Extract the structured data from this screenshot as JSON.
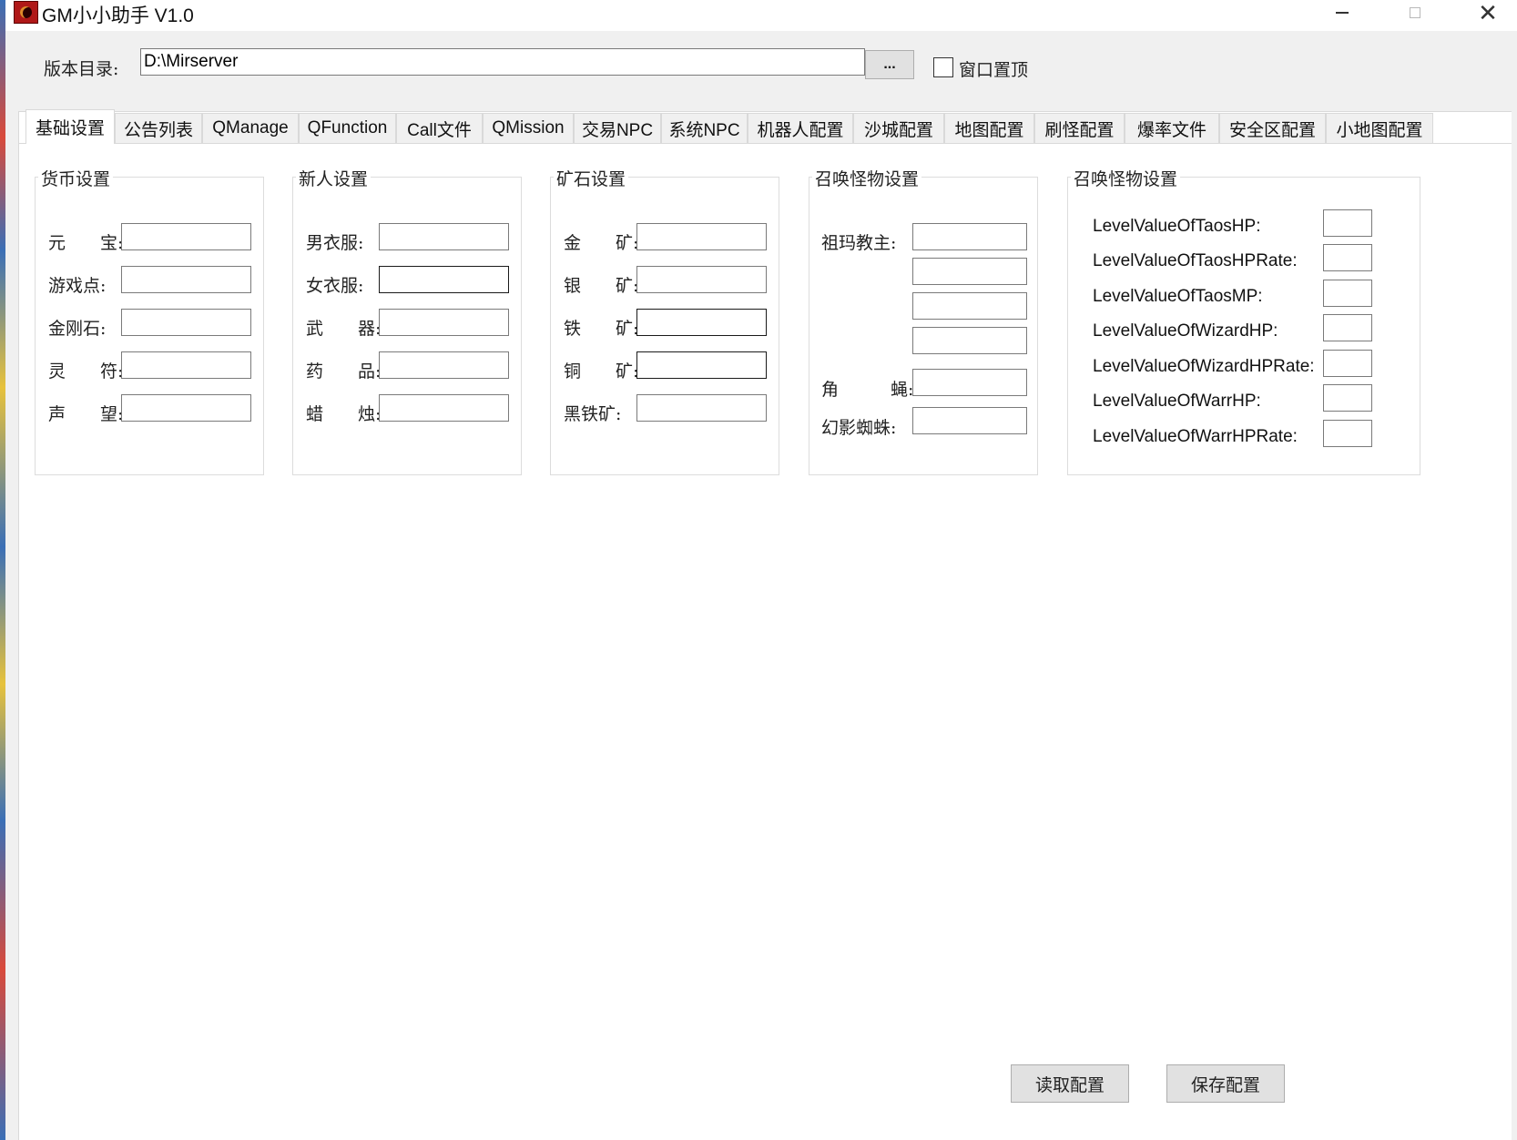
{
  "window": {
    "title": "GM小小助手 V1.0",
    "minimize_glyph": "—",
    "maximize_glyph": "□",
    "close_glyph": "✕"
  },
  "version_row": {
    "label": "版本目录:",
    "path_value": "D:\\Mirserver",
    "browse_label": "...",
    "topmost_label": "窗口置顶",
    "topmost_checked": false
  },
  "tabs": [
    {
      "label": "基础设置",
      "active": true
    },
    {
      "label": "公告列表"
    },
    {
      "label": "QManage"
    },
    {
      "label": "QFunction"
    },
    {
      "label": "Call文件"
    },
    {
      "label": "QMission"
    },
    {
      "label": "交易NPC"
    },
    {
      "label": "系统NPC"
    },
    {
      "label": "机器人配置"
    },
    {
      "label": "沙城配置"
    },
    {
      "label": "地图配置"
    },
    {
      "label": "刷怪配置"
    },
    {
      "label": "爆率文件"
    },
    {
      "label": "安全区配置"
    },
    {
      "label": "小地图配置"
    }
  ],
  "groups": {
    "currency": {
      "title": "货币设置",
      "fields": [
        {
          "label": "元　　宝:",
          "value": ""
        },
        {
          "label": "游戏点:",
          "value": ""
        },
        {
          "label": "金刚石:",
          "value": ""
        },
        {
          "label": "灵　　符:",
          "value": ""
        },
        {
          "label": "声　　望:",
          "value": ""
        }
      ]
    },
    "newbie": {
      "title": "新人设置",
      "fields": [
        {
          "label": "男衣服:",
          "value": ""
        },
        {
          "label": "女衣服:",
          "value": ""
        },
        {
          "label": "武　　器:",
          "value": ""
        },
        {
          "label": "药　　品:",
          "value": ""
        },
        {
          "label": "蜡　　烛:",
          "value": ""
        }
      ]
    },
    "ore": {
      "title": "矿石设置",
      "fields": [
        {
          "label": "金　　矿:",
          "value": ""
        },
        {
          "label": "银　　矿:",
          "value": ""
        },
        {
          "label": "铁　　矿:",
          "value": ""
        },
        {
          "label": "铜　　矿:",
          "value": ""
        },
        {
          "label": "黑铁矿:",
          "value": ""
        }
      ]
    },
    "summon1": {
      "title": "召唤怪物设置",
      "zuma_label": "祖玛教主:",
      "jiaoying_label": "角　　　蝇:",
      "spider_label": "幻影蜘蛛:"
    },
    "summon2": {
      "title": "召唤怪物设置",
      "fields": [
        {
          "label": "LevelValueOfTaosHP:",
          "value": ""
        },
        {
          "label": "LevelValueOfTaosHPRate:",
          "value": ""
        },
        {
          "label": "LevelValueOfTaosMP:",
          "value": ""
        },
        {
          "label": "LevelValueOfWizardHP:",
          "value": ""
        },
        {
          "label": "LevelValueOfWizardHPRate:",
          "value": ""
        },
        {
          "label": "LevelValueOfWarrHP:",
          "value": ""
        },
        {
          "label": "LevelValueOfWarrHPRate:",
          "value": ""
        }
      ]
    }
  },
  "buttons": {
    "read_config": "读取配置",
    "save_config": "保存配置"
  }
}
